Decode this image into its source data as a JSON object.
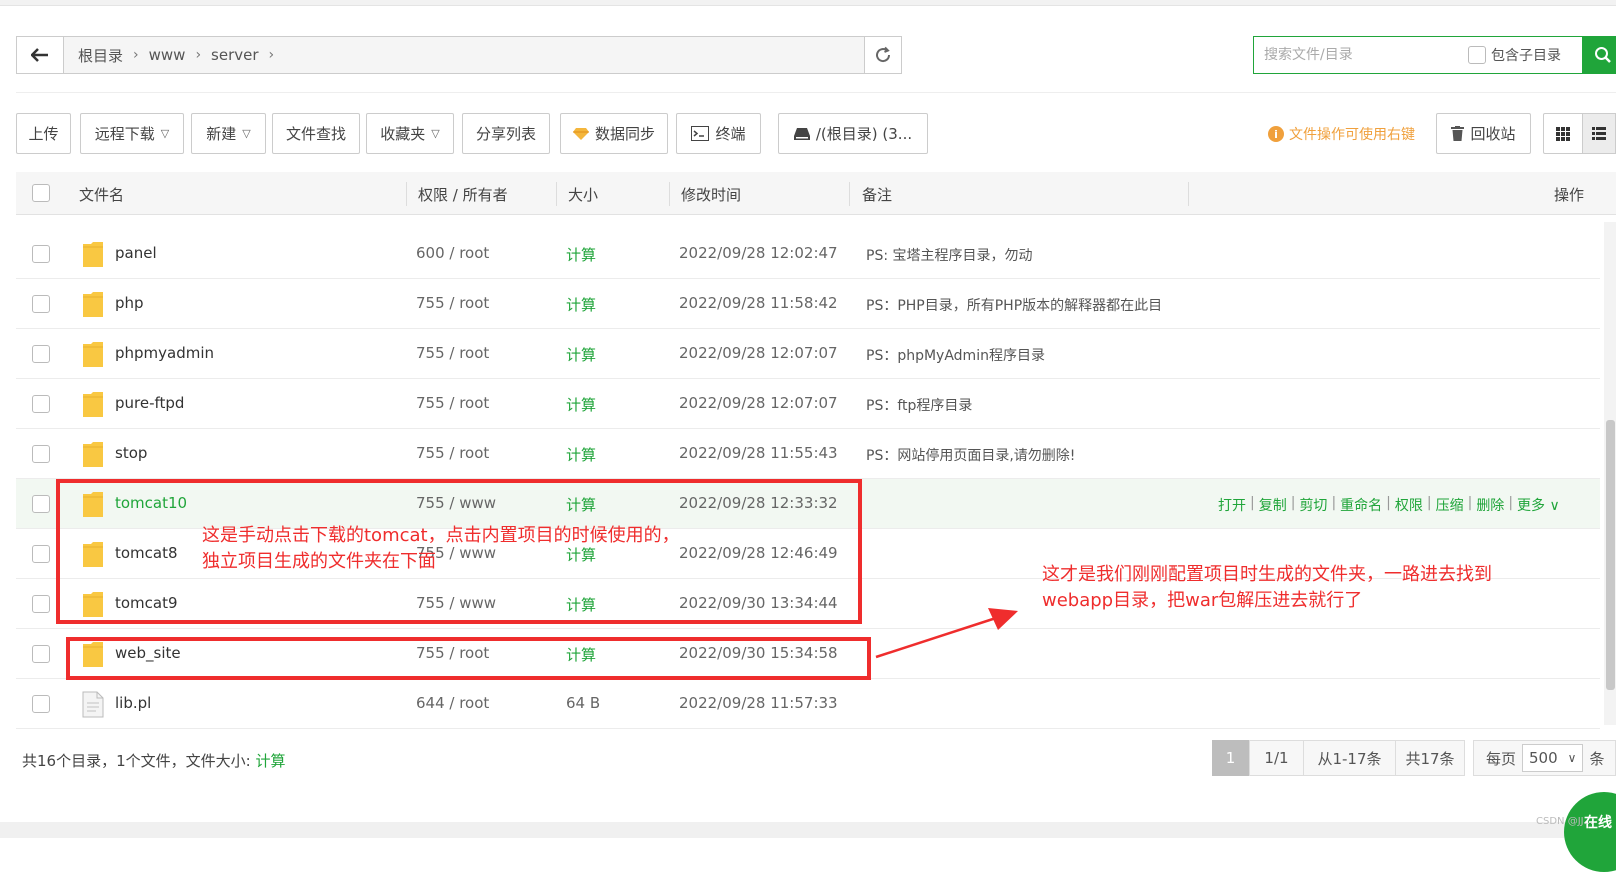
{
  "pathbar": {
    "crumbs": [
      "根目录",
      "www",
      "server"
    ]
  },
  "search": {
    "placeholder": "搜索文件/目录",
    "subdir_label": "包含子目录"
  },
  "toolbar": {
    "upload": "上传",
    "remote_download": "远程下载",
    "new": "新建",
    "file_search": "文件查找",
    "favorites": "收藏夹",
    "share_list": "分享列表",
    "data_sync": "数据同步",
    "terminal": "终端",
    "disk": "/(根目录) (3...",
    "tip": "文件操作可使用右键",
    "recycle": "回收站"
  },
  "table": {
    "headers": {
      "name": "文件名",
      "perm": "权限 / 所有者",
      "size": "大小",
      "mtime": "修改时间",
      "note": "备注",
      "ops": "操作"
    },
    "rows": [
      {
        "name": "panel",
        "perm": "600 / root",
        "size": "计算",
        "mtime": "2022/09/28 12:02:47",
        "note": "PS: 宝塔主程序目录，勿动"
      },
      {
        "name": "php",
        "perm": "755 / root",
        "size": "计算",
        "mtime": "2022/09/28 11:58:42",
        "note": "PS：PHP目录，所有PHP版本的解释器都在此目"
      },
      {
        "name": "phpmyadmin",
        "perm": "755 / root",
        "size": "计算",
        "mtime": "2022/09/28 12:07:07",
        "note": "PS：phpMyAdmin程序目录"
      },
      {
        "name": "pure-ftpd",
        "perm": "755 / root",
        "size": "计算",
        "mtime": "2022/09/28 12:07:07",
        "note": "PS：ftp程序目录"
      },
      {
        "name": "stop",
        "perm": "755 / root",
        "size": "计算",
        "mtime": "2022/09/28 11:55:43",
        "note": "PS：网站停用页面目录,请勿删除!"
      },
      {
        "name": "tomcat10",
        "perm": "755 / www",
        "size": "计算",
        "mtime": "2022/09/28 12:33:32",
        "note": ""
      },
      {
        "name": "tomcat8",
        "perm": "755 / www",
        "size": "计算",
        "mtime": "2022/09/28 12:46:49",
        "note": ""
      },
      {
        "name": "tomcat9",
        "perm": "755 / www",
        "size": "计算",
        "mtime": "2022/09/30 13:34:44",
        "note": ""
      },
      {
        "name": "web_site",
        "perm": "755 / root",
        "size": "计算",
        "mtime": "2022/09/30 15:34:58",
        "note": ""
      },
      {
        "name": "lib.pl",
        "perm": "644 / root",
        "size": "64 B",
        "mtime": "2022/09/28 11:57:33",
        "note": ""
      }
    ],
    "row_ops": [
      "打开",
      "复制",
      "剪切",
      "重命名",
      "权限",
      "压缩",
      "删除",
      "更多"
    ]
  },
  "annotations": {
    "box1_line1": "这是手动点击下载的tomcat，点击内置项目的时候使用的，",
    "box1_line2": "独立项目生成的文件夹在下面",
    "note2_line1": "这才是我们刚刚配置项目时生成的文件夹，一路进去找到",
    "note2_line2": "webapp目录，把war包解压进去就行了"
  },
  "footer": {
    "summary_prefix": "共16个目录，1个文件，文件大小:",
    "summary_calc": "计算",
    "page_current": "1",
    "page_total": "1/1",
    "range": "从1-17条",
    "count": "共17条",
    "perpage_prefix": "每页",
    "perpage_value": "500",
    "perpage_suffix": "条"
  },
  "online_service": "在线",
  "watermark": "CSDN @JJ..."
}
